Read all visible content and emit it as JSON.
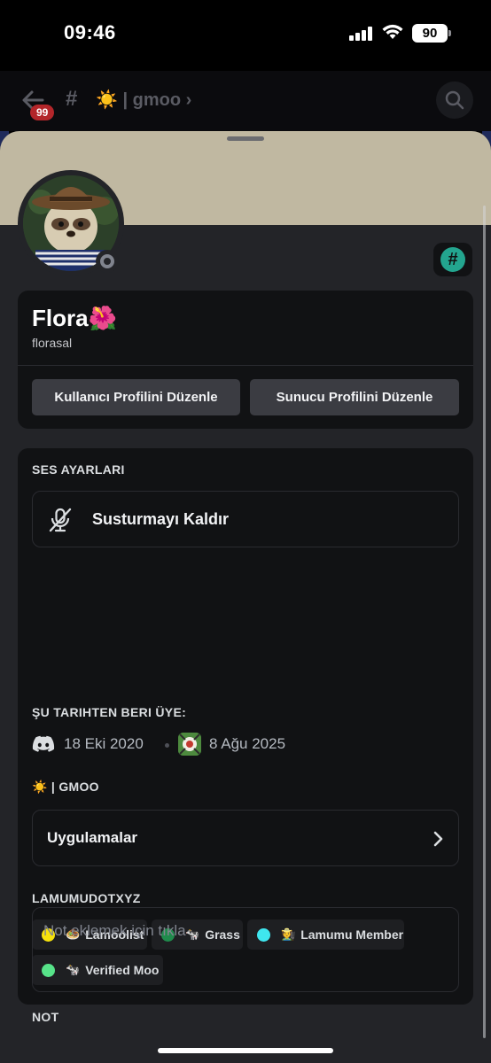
{
  "status_bar": {
    "time": "09:46",
    "battery": "90"
  },
  "background": {
    "unread_badge": "99",
    "channel_prefix": "#",
    "channel_name": "☀️ | gmoo ›"
  },
  "profile": {
    "display_name": "Flora🌺",
    "username": "florasal",
    "buttons": {
      "edit_user_profile": "Kullanıcı Profilini Düzenle",
      "edit_server_profile": "Sunucu Profilini Düzenle"
    }
  },
  "voice_settings": {
    "title": "SES AYARLARI",
    "unmute_label": "Susturmayı Kaldır"
  },
  "member_since": {
    "title": "ŞU TARIHTEN BERI ÜYE:",
    "discord_date": "18 Eki 2020",
    "server_date": "8 Ağu 2025"
  },
  "server_section": {
    "title": "☀️ | GMOO",
    "apps_label": "Uygulamalar"
  },
  "roles_section": {
    "title": "LAMUMUDOTXYZ",
    "roles": [
      {
        "name": "Lamoolist",
        "emoji": "🧆",
        "color": "#f6e20c"
      },
      {
        "name": "Grass",
        "emoji": "🐄",
        "color": "#1f8b4c"
      },
      {
        "name": "Lamumu Member",
        "emoji": "🧑‍🌾",
        "color": "#3fe6ef"
      },
      {
        "name": "Verified Moo",
        "emoji": "🐄",
        "color": "#57e389"
      }
    ]
  },
  "note": {
    "title": "NOT",
    "placeholder": "Not eklemek için tıkla"
  }
}
